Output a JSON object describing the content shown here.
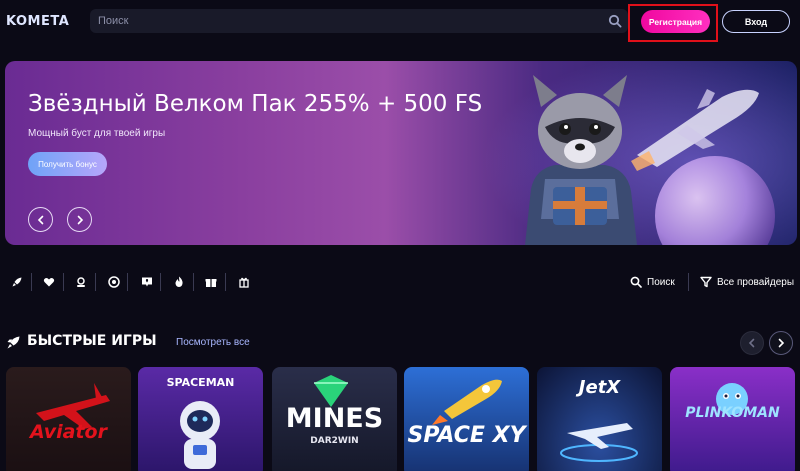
{
  "header": {
    "logo": "KOMETA",
    "search_placeholder": "Поиск",
    "register_label": "Регистрация",
    "login_label": "Вход"
  },
  "banner": {
    "title": "Звёздный Велком Пак 255% + 500 FS",
    "subtitle": "Мощный буст для твоей игры",
    "cta_label": "Получить бонус"
  },
  "category_bar": {
    "icons": [
      "rocket-icon",
      "heart-icon",
      "user-badge-icon",
      "chip-icon",
      "chat-icon",
      "flame-icon",
      "gift-box-icon",
      "present-icon"
    ],
    "search_label": "Поиск",
    "providers_label": "Все провайдеры"
  },
  "section": {
    "title": "БЫСТРЫЕ ИГРЫ",
    "see_all_label": "Посмотреть все"
  },
  "games": [
    {
      "name": "Aviator"
    },
    {
      "name": "SPACEMAN"
    },
    {
      "name": "MINES",
      "sub": "DAR2WIN"
    },
    {
      "name": "SPACE XY"
    },
    {
      "name": "JetX"
    },
    {
      "name": "PLINKOMAN"
    }
  ],
  "colors": {
    "background": "#0b0a16",
    "accent_pink": "#f0089f",
    "highlight_red": "#e0101a"
  }
}
